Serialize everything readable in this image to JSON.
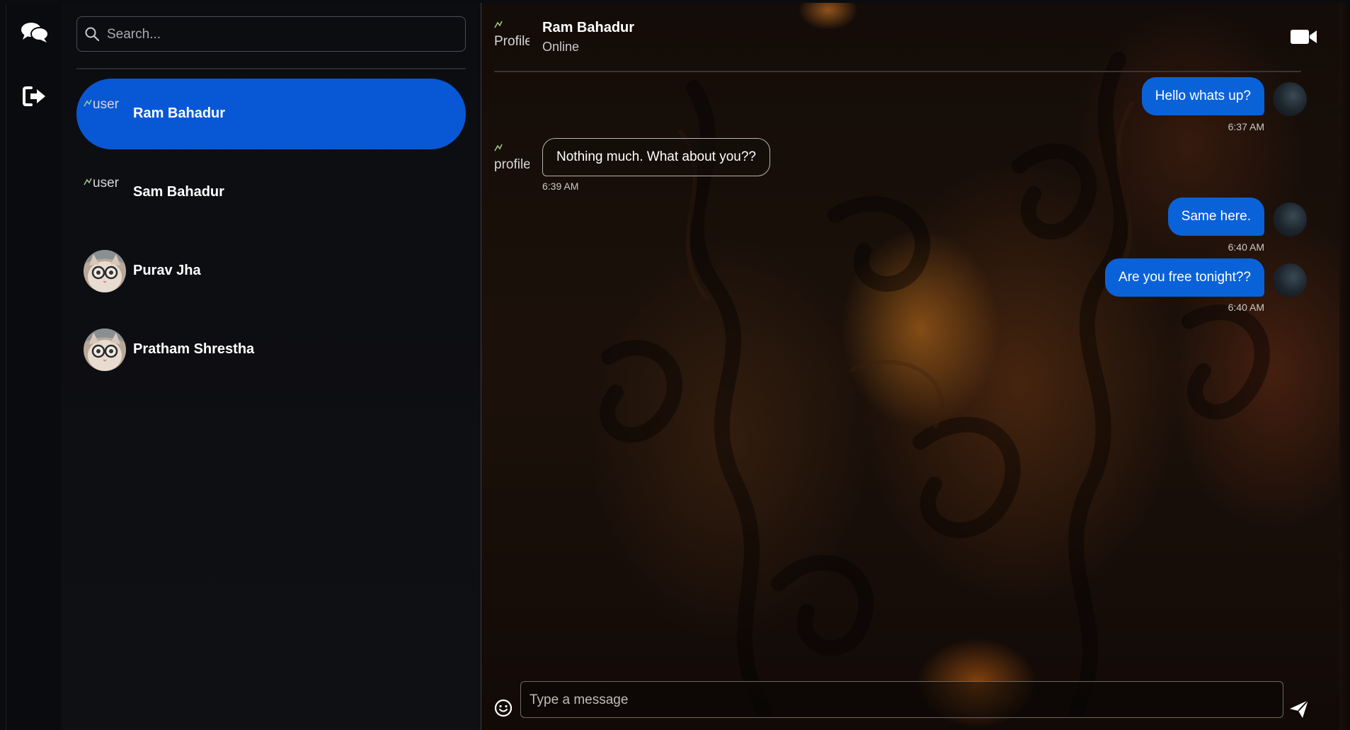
{
  "rail": {
    "chats_icon": "chat-bubbles-icon",
    "logout_icon": "sign-out-icon"
  },
  "sidebar": {
    "search": {
      "placeholder": "Search...",
      "value": ""
    },
    "contacts": [
      {
        "name": "Ram Bahadur",
        "avatar_alt": "user",
        "avatar": "broken-image",
        "active": true
      },
      {
        "name": "Sam Bahadur",
        "avatar_alt": "user",
        "avatar": "broken-image",
        "active": false
      },
      {
        "name": "Purav Jha",
        "avatar": "cat-with-glasses-photo",
        "active": false
      },
      {
        "name": "Pratham Shrestha",
        "avatar": "cat-with-glasses-photo",
        "active": false
      }
    ]
  },
  "chat": {
    "header": {
      "name": "Ram Bahadur",
      "status": "Online",
      "avatar_alt": "Profile",
      "video_icon": "video-camera-icon"
    },
    "messages": [
      {
        "direction": "out",
        "text": "Hello whats up?",
        "time": "6:37 AM"
      },
      {
        "direction": "in",
        "text": "Nothing much. What about you??",
        "time": "6:39 AM",
        "avatar_alt": "profile"
      },
      {
        "direction": "out",
        "text": "Same here.",
        "time": "6:40 AM"
      },
      {
        "direction": "out",
        "text": "Are you free tonight??",
        "time": "6:40 AM"
      }
    ],
    "composer": {
      "placeholder": "Type a message",
      "value": "",
      "emoji_icon": "smiley-icon",
      "send_icon": "paper-plane-icon"
    }
  },
  "colors": {
    "accent": "#0858d6",
    "bubble_out": "#0a62d9",
    "background": "#0b0c10"
  }
}
